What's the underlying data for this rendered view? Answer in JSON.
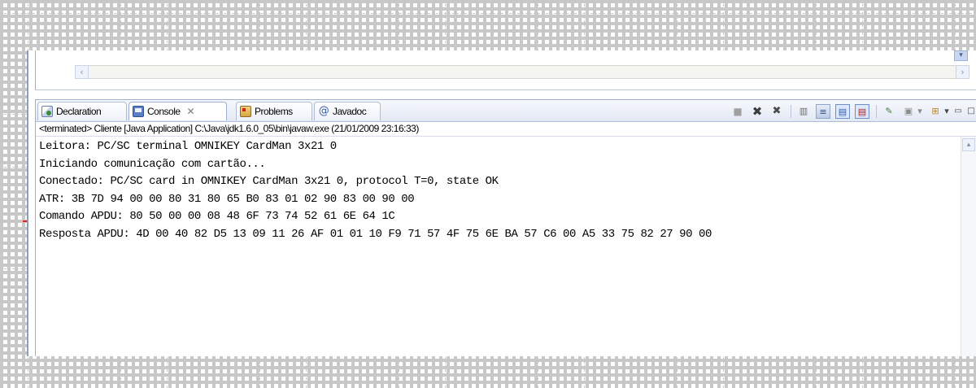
{
  "tabs": [
    {
      "label": "Declaration",
      "icon": "declaration-icon"
    },
    {
      "label": "Console",
      "icon": "console-icon",
      "active": true
    },
    {
      "label": "Problems",
      "icon": "problems-icon"
    },
    {
      "label": "Javadoc",
      "icon": "javadoc-icon"
    }
  ],
  "console_close": "✕",
  "toolbar": {
    "terminate": "■",
    "remove_launch": "✖",
    "remove_all": "✖",
    "scroll_lock": "≡",
    "show_stdout": "▤",
    "show_stderr": "▤",
    "pin": "✎",
    "display_console": "▣",
    "display_dropdown": "▾",
    "open_console": "⊞",
    "open_dropdown": "▾",
    "minimize": "▭",
    "maximize": "□"
  },
  "status": "<terminated> Cliente [Java Application] C:\\Java\\jdk1.6.0_05\\bin\\javaw.exe (21/01/2009 23:16:33)",
  "console_lines": [
    "Leitora: PC/SC terminal OMNIKEY CardMan 3x21 0",
    "Iniciando comunicação com cartão...",
    "Conectado: PC/SC card in OMNIKEY CardMan 3x21 0, protocol T=0, state OK",
    "ATR: 3B 7D 94 00 00 80 31 80 65 B0 83 01 02 90 83 00 90 00",
    "Comando APDU: 80 50 00 00 08 48 6F 73 74 52 61 6E 64 1C",
    "Resposta APDU: 4D 00 40 82 D5 13 09 11 26 AF 01 01 10 F9 71 57 4F 75 6E BA 57 C6 00 A5 33 75 82 27 90 00"
  ],
  "scroll": {
    "left_arrow": "‹",
    "right_arrow": "›",
    "down_arrow": "▾",
    "up_arrow": "▴"
  },
  "colors": {
    "tab_border": "#9aaed0",
    "text": "#000000",
    "grid": "#c8c8c8",
    "marker_red": "#e02020"
  }
}
